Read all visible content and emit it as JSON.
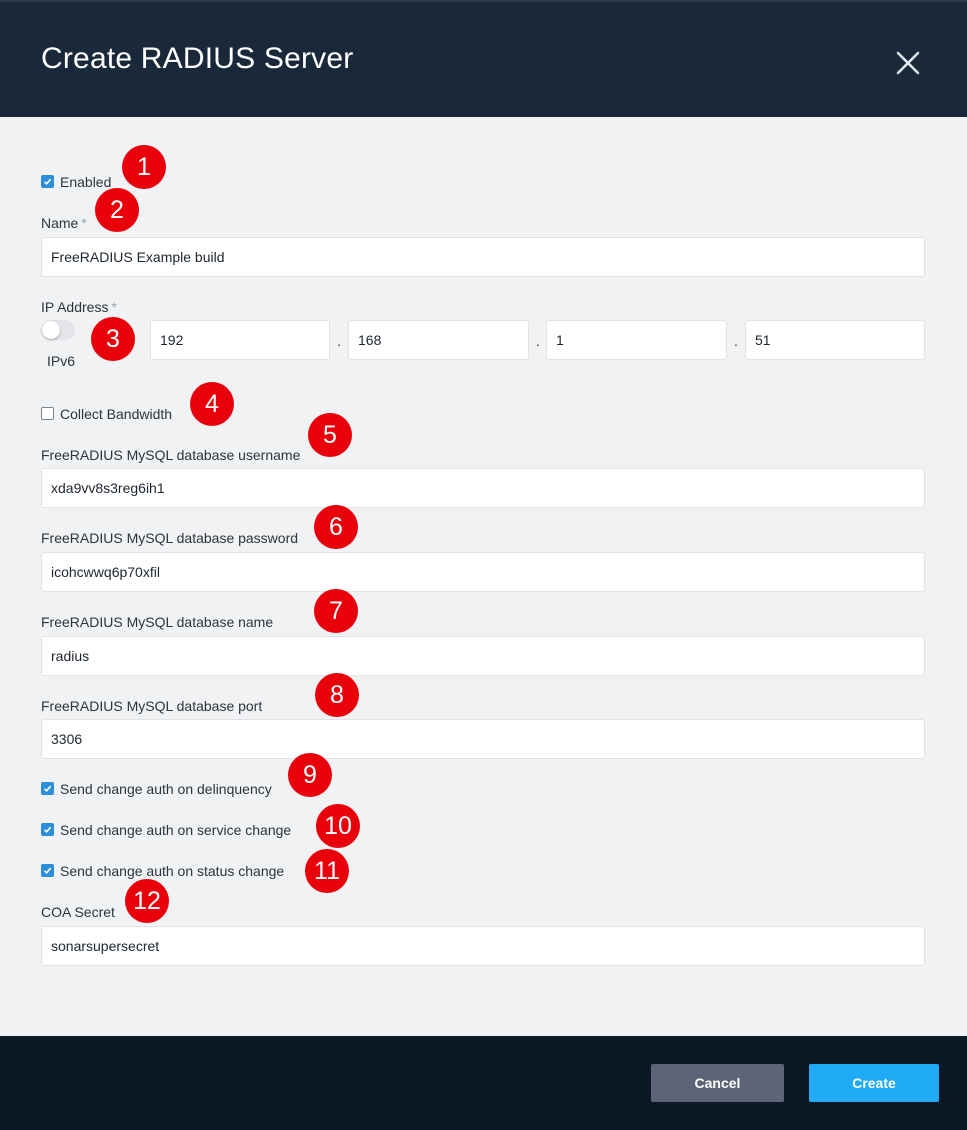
{
  "dialog": {
    "title": "Create RADIUS Server",
    "close_icon": "close-icon"
  },
  "form": {
    "enabled": {
      "label": "Enabled",
      "checked": true
    },
    "name": {
      "label": "Name",
      "required_mark": "*",
      "value": "FreeRADIUS Example build"
    },
    "ip_address": {
      "label": "IP Address",
      "required_mark": "*",
      "ipv6_label": "IPv6",
      "ipv6_enabled": false,
      "octets": [
        "192",
        "168",
        "1",
        "51"
      ],
      "separator": "."
    },
    "collect_bandwidth": {
      "label": "Collect Bandwidth",
      "checked": false
    },
    "db_username": {
      "label": "FreeRADIUS MySQL database username",
      "value": "xda9vv8s3reg6ih1"
    },
    "db_password": {
      "label": "FreeRADIUS MySQL database password",
      "value": "icohcwwq6p70xfil"
    },
    "db_name": {
      "label": "FreeRADIUS MySQL database name",
      "value": "radius"
    },
    "db_port": {
      "label": "FreeRADIUS MySQL database port",
      "value": "3306"
    },
    "coa_delinquency": {
      "label": "Send change auth on delinquency",
      "checked": true
    },
    "coa_service": {
      "label": "Send change auth on service change",
      "checked": true
    },
    "coa_status": {
      "label": "Send change auth on status change",
      "checked": true
    },
    "coa_secret": {
      "label": "COA Secret",
      "value": "sonarsupersecret"
    }
  },
  "annotations": [
    "1",
    "2",
    "3",
    "4",
    "5",
    "6",
    "7",
    "8",
    "9",
    "10",
    "11",
    "12"
  ],
  "footer": {
    "cancel_label": "Cancel",
    "create_label": "Create"
  },
  "colors": {
    "header_bg": "#19293a",
    "body_bg": "#f1f2f4",
    "footer_bg": "#0c1826",
    "accent": "#20aaf5",
    "checkbox": "#2d8fd9",
    "annotation": "#e8000b",
    "cancel_bg": "#5b6577"
  }
}
